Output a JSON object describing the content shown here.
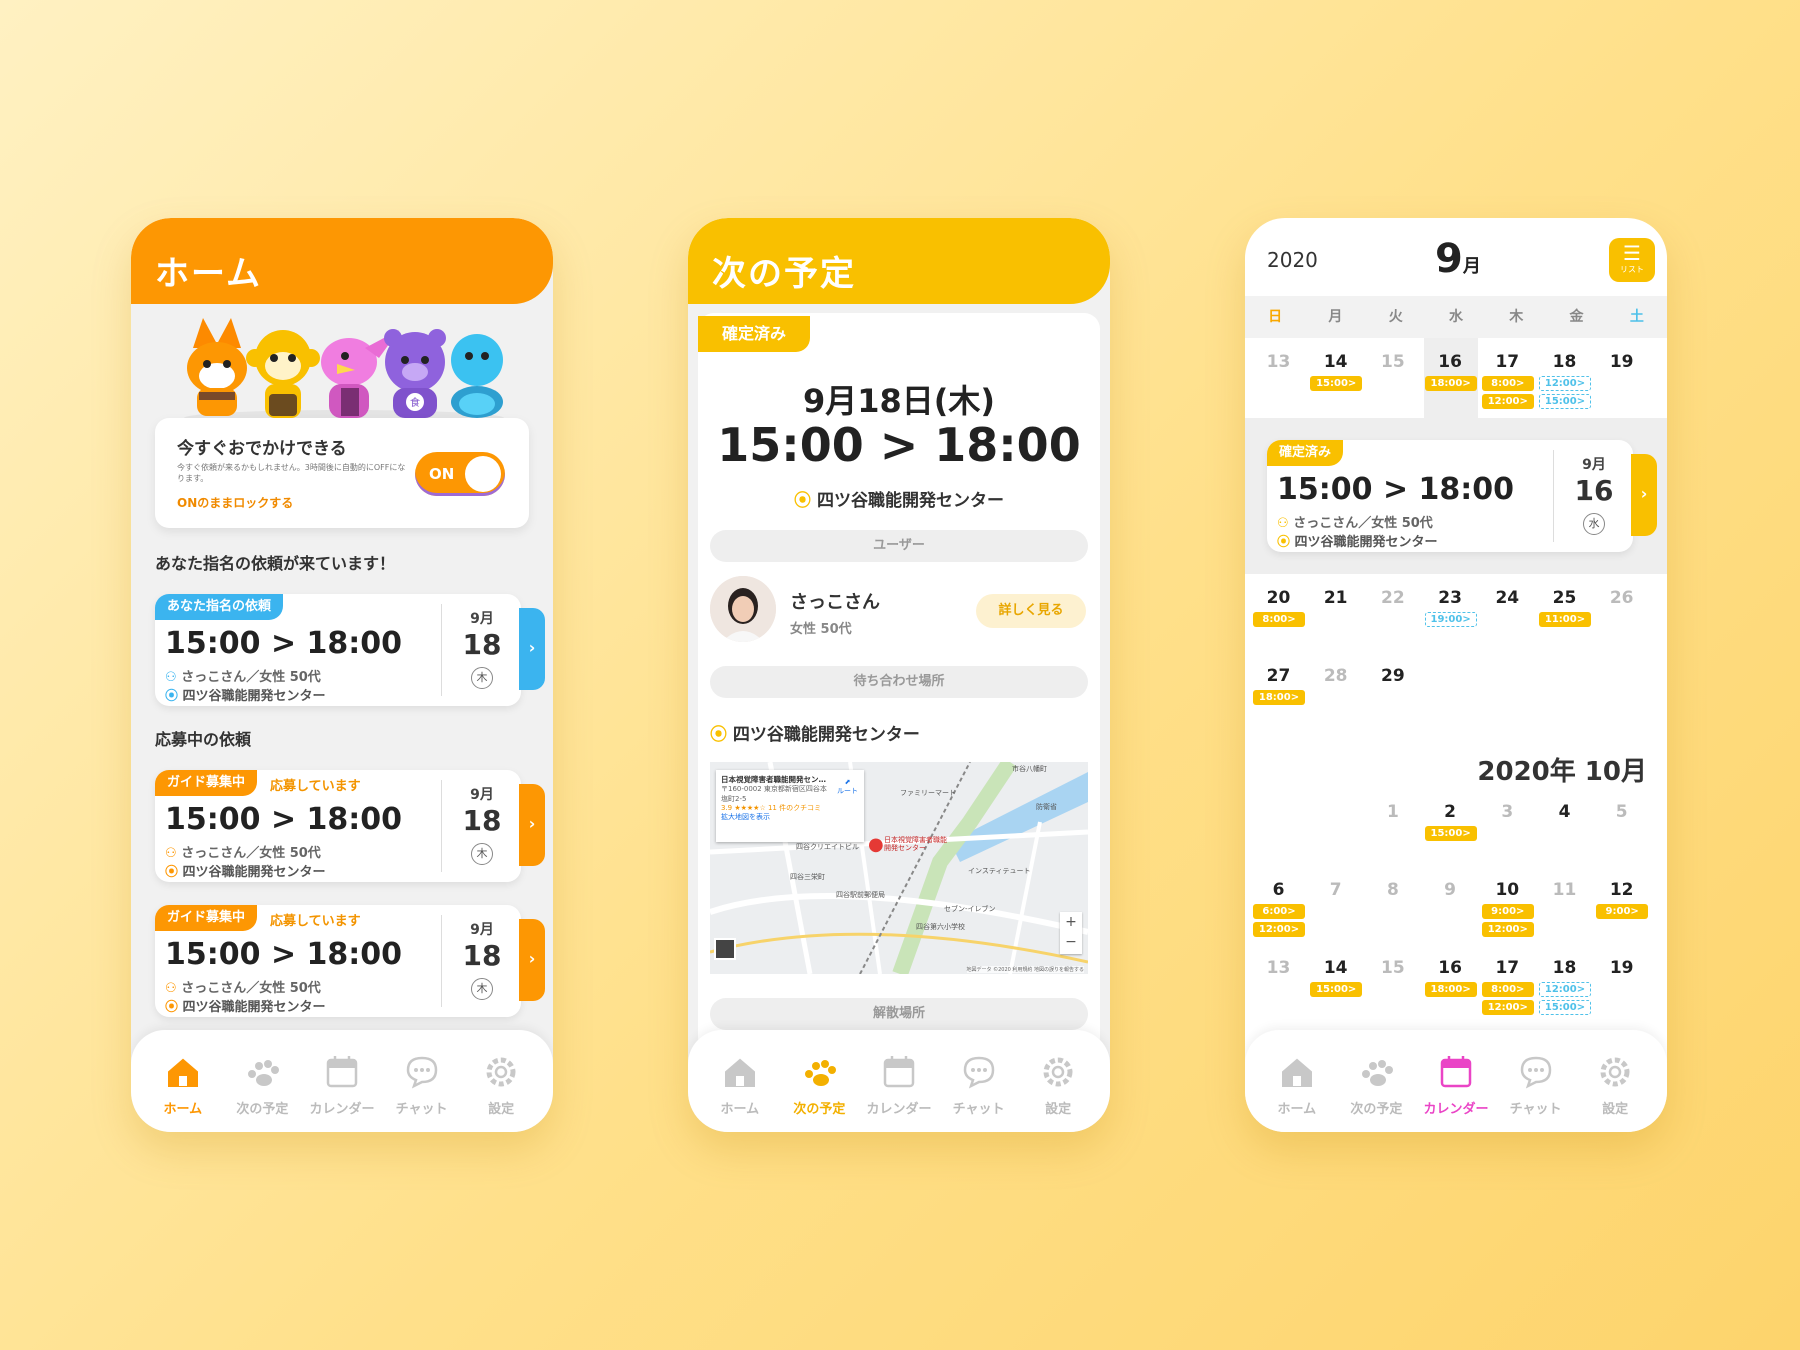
{
  "colors": {
    "orange": "#fd9703",
    "yellow": "#f9c000",
    "blue": "#3bb4ef",
    "pink": "#ea44c6"
  },
  "tabs": [
    {
      "label": "ホーム",
      "icon": "home-icon"
    },
    {
      "label": "次の予定",
      "icon": "paw-icon"
    },
    {
      "label": "カレンダー",
      "icon": "calendar-icon"
    },
    {
      "label": "チャット",
      "icon": "chat-icon"
    },
    {
      "label": "設定",
      "icon": "gear-icon"
    }
  ],
  "home": {
    "title": "ホーム",
    "online": {
      "title": "今すぐおでかけできる",
      "desc": "今すぐ依頼が来るかもしれません。3時間後に自動的にOFFになります。",
      "lock": "ONのままロックする",
      "toggle": "ON"
    },
    "section_nominated": "あなた指名の依頼が来ています！",
    "section_applying": "応募中の依頼",
    "requests": [
      {
        "badge": "あなた指名の依頼",
        "status": "",
        "time": "15:00 > 18:00",
        "user": "さっこさん／女性 50代",
        "place": "四ツ谷職能開発センター",
        "month": "9月",
        "day": "18",
        "weekday": "木"
      },
      {
        "badge": "ガイド募集中",
        "status": "応募しています",
        "time": "15:00 > 18:00",
        "user": "さっこさん／女性 50代",
        "place": "四ツ谷職能開発センター",
        "month": "9月",
        "day": "18",
        "weekday": "木"
      },
      {
        "badge": "ガイド募集中",
        "status": "応募しています",
        "time": "15:00 > 18:00",
        "user": "さっこさん／女性 50代",
        "place": "四ツ谷職能開発センター",
        "month": "9月",
        "day": "18",
        "weekday": "木"
      }
    ]
  },
  "next": {
    "title": "次の予定",
    "badge": "確定済み",
    "date": "9月18日(木)",
    "time": "15:00 > 18:00",
    "place": "四ツ谷職能開発センター",
    "user_label": "ユーザー",
    "user_name": "さっこさん",
    "user_info": "女性 50代",
    "more": "詳しく見る",
    "meet_label": "待ち合わせ場所",
    "meet_place": "四ツ谷職能開発センター",
    "map": {
      "name": "日本視覚障害者職能開発セン…",
      "addr": "〒160-0002 東京都新宿区四谷本塩町2-5",
      "rating": "3.9 ★★★★☆ 11 件のクチコミ",
      "enlarge": "拡大地図を表示",
      "route": "ルート",
      "pin": "日本視覚障害者職能開発センター",
      "labels": [
        "ファミリーマート",
        "四谷クリエイトビル",
        "四谷三栄町",
        "四谷駅前郵便局",
        "四谷第六小学校",
        "セブン-イレブン",
        "インスティテュート",
        "市谷八幡町",
        "防衛省"
      ],
      "zoom_in": "+",
      "zoom_out": "−",
      "footer": "地図データ ©2020 利用規約 地図の誤りを報告する"
    },
    "disband_label": "解散場所"
  },
  "calendar": {
    "year": "2020",
    "month": "9",
    "month_unit": "月",
    "list_label": "リスト",
    "weekdays": [
      "日",
      "月",
      "火",
      "水",
      "木",
      "金",
      "土"
    ],
    "sep": [
      {
        "week": [
          {
            "d": "13",
            "g": true
          },
          {
            "d": "14",
            "ev": [
              "15:00>"
            ]
          },
          {
            "d": "15",
            "g": true
          },
          {
            "d": "16",
            "ev": [
              "18:00>"
            ],
            "sel": true
          },
          {
            "d": "17",
            "ev": [
              "8:00>",
              "12:00>"
            ]
          },
          {
            "d": "18",
            "evb": [
              "12:00>",
              "15:00>"
            ]
          },
          {
            "d": "19"
          }
        ]
      },
      {
        "week": [
          {
            "d": "20",
            "ev": [
              "8:00>"
            ]
          },
          {
            "d": "21"
          },
          {
            "d": "22",
            "g": true
          },
          {
            "d": "23",
            "evb": [
              "19:00>"
            ]
          },
          {
            "d": "24"
          },
          {
            "d": "25",
            "ev": [
              "11:00>"
            ]
          },
          {
            "d": "26",
            "g": true
          }
        ]
      },
      {
        "week": [
          {
            "d": "27",
            "ev": [
              "18:00>"
            ]
          },
          {
            "d": "28",
            "g": true
          },
          {
            "d": "29"
          }
        ]
      }
    ],
    "selected": {
      "badge": "確定済み",
      "time": "15:00 > 18:00",
      "user": "さっこさん／女性 50代",
      "place": "四ツ谷職能開発センター",
      "month": "9月",
      "day": "16",
      "weekday": "水"
    },
    "oct_title": "2020年 10月",
    "oct": [
      {
        "week": [
          {
            "d": ""
          },
          {
            "d": ""
          },
          {
            "d": "1",
            "g": true
          },
          {
            "d": "2",
            "ev": [
              "15:00>"
            ]
          },
          {
            "d": "3",
            "g": true
          },
          {
            "d": "4"
          },
          {
            "d": "5",
            "g": true
          }
        ]
      },
      {
        "week": [
          {
            "d": "6",
            "ev": [
              "6:00>",
              "12:00>"
            ]
          },
          {
            "d": "7",
            "g": true
          },
          {
            "d": "8",
            "g": true
          },
          {
            "d": "9",
            "g": true
          },
          {
            "d": "10",
            "ev": [
              "9:00>",
              "12:00>"
            ]
          },
          {
            "d": "11",
            "g": true
          },
          {
            "d": "12",
            "ev": [
              "9:00>"
            ]
          }
        ]
      },
      {
        "week": [
          {
            "d": "13",
            "g": true
          },
          {
            "d": "14",
            "ev": [
              "15:00>"
            ]
          },
          {
            "d": "15",
            "g": true
          },
          {
            "d": "16",
            "ev": [
              "18:00>"
            ]
          },
          {
            "d": "17",
            "ev": [
              "8:00>",
              "12:00>"
            ]
          },
          {
            "d": "18",
            "evb": [
              "12:00>",
              "15:00>"
            ]
          },
          {
            "d": "19"
          }
        ]
      }
    ]
  }
}
